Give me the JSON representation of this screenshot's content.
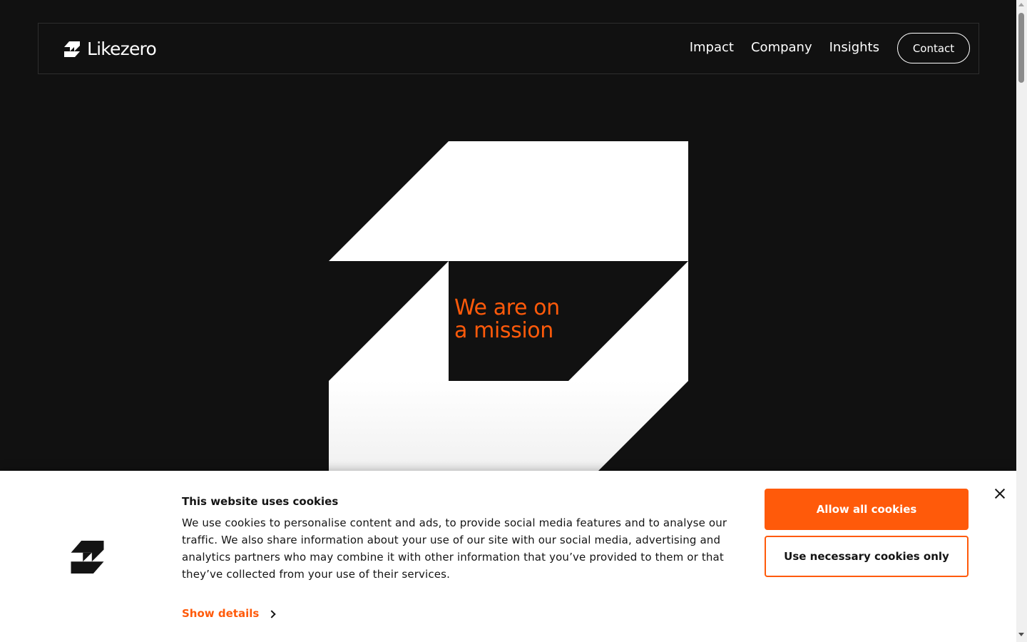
{
  "header": {
    "brand": "Likezero",
    "nav": [
      {
        "label": "Impact"
      },
      {
        "label": "Company"
      },
      {
        "label": "Insights"
      }
    ],
    "contact_label": "Contact"
  },
  "hero": {
    "tagline_line1": "We are on",
    "tagline_line2": "a mission"
  },
  "cookie_banner": {
    "title": "This website uses cookies",
    "body": "We use cookies to personalise content and ads, to provide social media features and to analyse our traffic. We also share information about your use of our site with our social media, advertising and analytics partners who may combine it with other information that you’ve provided to them or that they’ve collected from your use of their services.",
    "show_details_label": "Show details",
    "allow_all_label": "Allow all cookies",
    "necessary_only_label": "Use necessary cookies only"
  },
  "colors": {
    "background": "#111111",
    "accent": "#ff5a0a",
    "foreground": "#ffffff"
  },
  "icons": [
    "likezero-logo-icon",
    "chevron-right-icon",
    "close-icon"
  ]
}
